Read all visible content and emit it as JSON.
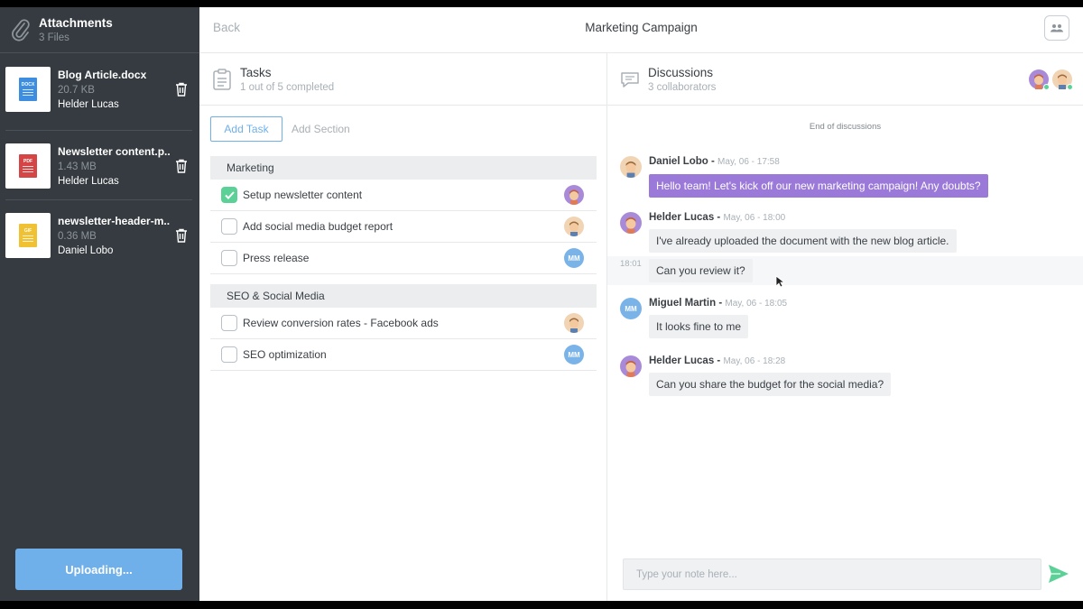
{
  "sidebar": {
    "title": "Attachments",
    "subtitle": "3 Files",
    "files": [
      {
        "name": "Blog Article.docx",
        "size": "20.7 KB",
        "owner": "Helder Lucas",
        "type": "DOCX",
        "color": "#3d8ee0"
      },
      {
        "name": "Newsletter content.p..",
        "size": "1.43 MB",
        "owner": "Helder Lucas",
        "type": "PDF",
        "color": "#d64545"
      },
      {
        "name": "newsletter-header-m..",
        "size": "0.36 MB",
        "owner": "Daniel Lobo",
        "type": "GIF",
        "color": "#f0c233"
      }
    ],
    "upload_label": "Uploading..."
  },
  "topbar": {
    "back_label": "Back",
    "title": "Marketing Campaign"
  },
  "tasks": {
    "title": "Tasks",
    "subtitle": "1 out of 5 completed",
    "add_task_label": "Add Task",
    "add_section_label": "Add Section",
    "sections": [
      {
        "name": "Marketing",
        "items": [
          {
            "label": "Setup newsletter content",
            "done": true,
            "assignee": "helder"
          },
          {
            "label": "Add social media budget report",
            "done": false,
            "assignee": "daniel"
          },
          {
            "label": "Press release",
            "done": false,
            "assignee": "MM"
          }
        ]
      },
      {
        "name": "SEO & Social Media",
        "items": [
          {
            "label": "Review conversion rates - Facebook ads",
            "done": false,
            "assignee": "daniel"
          },
          {
            "label": "SEO optimization",
            "done": false,
            "assignee": "MM"
          }
        ]
      }
    ]
  },
  "discussions": {
    "title": "Discussions",
    "subtitle": "3 collaborators",
    "end_label": "End of discussions",
    "messages": [
      {
        "author": "Daniel Lobo",
        "time": "May, 06 - 17:58",
        "text": "Hello team! Let's kick off our new marketing campaign! Any doubts?"
      },
      {
        "author": "Helder Lucas",
        "time": "May, 06 - 18:00",
        "text": "I've already uploaded the document with the new blog article."
      },
      {
        "followup_time": "18:01",
        "text": "Can you review it?"
      },
      {
        "author": "Miguel Martin",
        "time": "May, 06 - 18:05",
        "text": "It looks fine to me"
      },
      {
        "author": "Helder Lucas",
        "time": "May, 06 - 18:28",
        "text": "Can you share the budget for the social media?"
      }
    ],
    "input_placeholder": "Type your note here...",
    "mm_initials": "MM"
  },
  "colors": {
    "sidebar_bg": "#353b40",
    "accent_blue": "#6fb0ea",
    "purple_bubble": "#9b79d9",
    "check_green": "#5cd197"
  }
}
